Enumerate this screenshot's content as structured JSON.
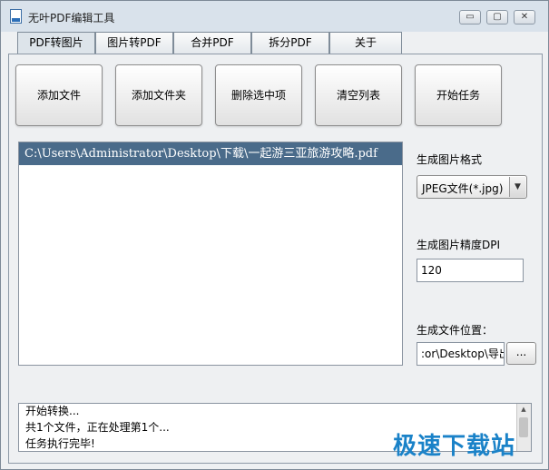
{
  "window": {
    "title": "无叶PDF编辑工具",
    "icon": "pdf-app-icon"
  },
  "window_controls": {
    "minimize": "▭",
    "restore": "▢",
    "close": "✕"
  },
  "tabs": [
    {
      "label": "PDF转图片",
      "active": true
    },
    {
      "label": "图片转PDF",
      "active": false
    },
    {
      "label": "合并PDF",
      "active": false
    },
    {
      "label": "拆分PDF",
      "active": false
    },
    {
      "label": "关于",
      "active": false
    }
  ],
  "toolbar": {
    "add_file": "添加文件",
    "add_folder": "添加文件夹",
    "delete_selected": "删除选中项",
    "clear_list": "清空列表",
    "start_task": "开始任务"
  },
  "file_list": [
    {
      "path": "C:\\Users\\Administrator\\Desktop\\下载\\一起游三亚旅游攻略.pdf",
      "selected": true
    }
  ],
  "settings": {
    "format_label": "生成图片格式",
    "format_value": "JPEG文件(*.jpg)",
    "dpi_label": "生成图片精度DPI",
    "dpi_value": "120",
    "output_label": "生成文件位置：",
    "output_value": ":or\\Desktop\\导出",
    "browse_label": "..."
  },
  "log": [
    "开始转换...",
    "共1个文件，正在处理第1个...",
    "任务执行完毕!"
  ],
  "watermark": "极速下载站",
  "colors": {
    "selected_row": "#4a6b8a",
    "watermark": "#1a82c8"
  }
}
